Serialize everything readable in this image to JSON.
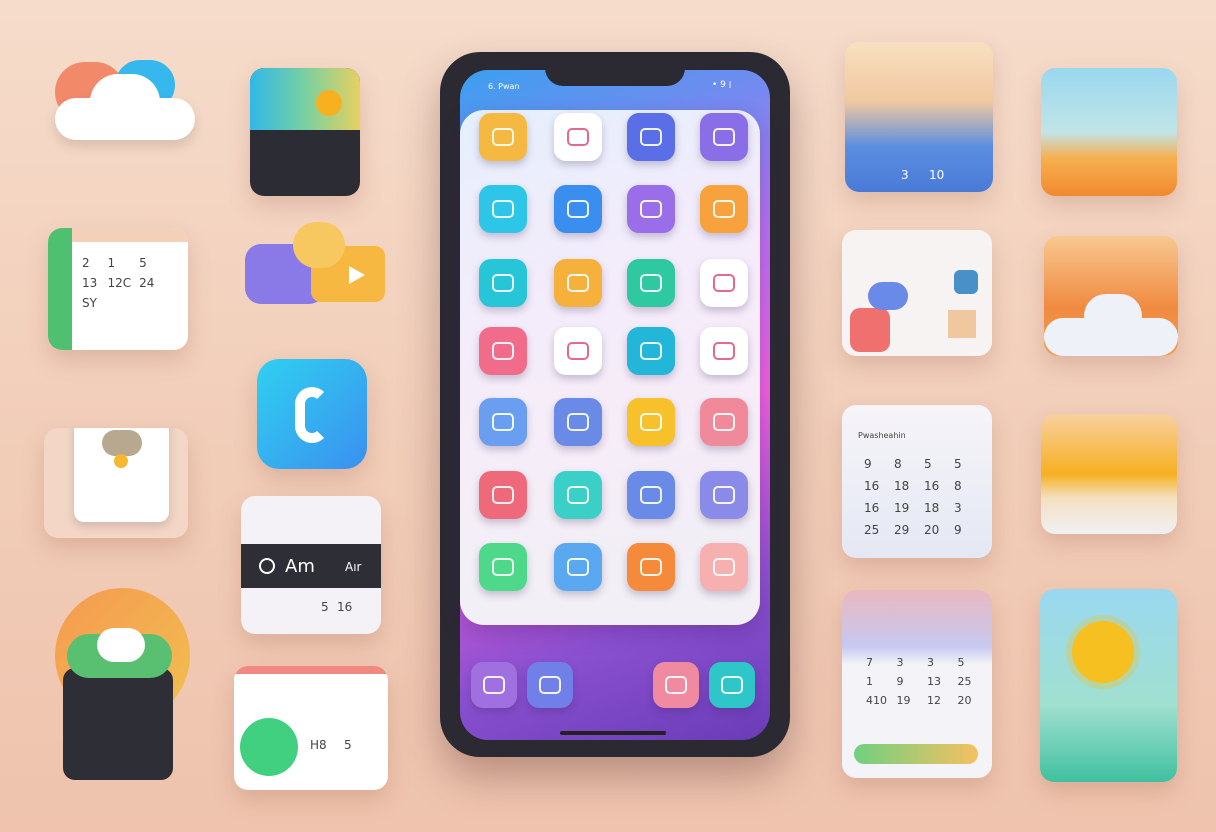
{
  "phone": {
    "status_text": "6. Pwan",
    "status_icons": "• ׀ 9",
    "icon_rows": [
      [
        "#f5b942",
        "#ffffff",
        "#5a6ee8",
        "#8a6ee8"
      ],
      [
        "#2ec6e8",
        "#3a8ef0",
        "#9a6ee8",
        "#f7a23c"
      ],
      [
        "#26c6d8",
        "#f6b13c",
        "#2ec9a0",
        "#ffffff"
      ],
      [
        "#f06c8a",
        "#ffffff",
        "#22b6d8",
        "#ffffff"
      ],
      [
        "#6a9ef0",
        "#6a8ae8",
        "#f6c12a",
        "#f08a9a"
      ],
      [
        "#ee6a7a",
        "#3ad0c8",
        "#6a8ae8",
        "#8a8ae8"
      ],
      [
        "#4ed88a",
        "#5aa8f0",
        "#f58a3a",
        "#f6b0b0"
      ]
    ],
    "dock": [
      "#a070e0",
      "#7080e8",
      "#f08aa0",
      "#2ec6c8"
    ]
  },
  "widgets": {
    "left_calendar": {
      "cells": [
        "2",
        "1",
        "5",
        "13",
        "12C",
        "24",
        "SY",
        "",
        ""
      ]
    },
    "music": {
      "time": "Am",
      "label": "Aır",
      "numbers": [
        "5",
        "16"
      ]
    },
    "weather_top": {
      "numbers": [
        "3",
        "10"
      ]
    },
    "calendar_right": {
      "title": "Pwasheahin",
      "days": [
        "9",
        "8",
        "5",
        "5",
        "16",
        "18",
        "16",
        "8",
        "16",
        "19",
        "18",
        "3",
        "25",
        "29",
        "20",
        "9"
      ]
    },
    "calendar_bottom": {
      "days": [
        "7",
        "3",
        "3",
        "5",
        "1",
        "9",
        "13",
        "25",
        "410",
        "19",
        "12",
        "20"
      ]
    },
    "card_bottom": {
      "numbers": [
        "H8",
        "5"
      ]
    }
  }
}
